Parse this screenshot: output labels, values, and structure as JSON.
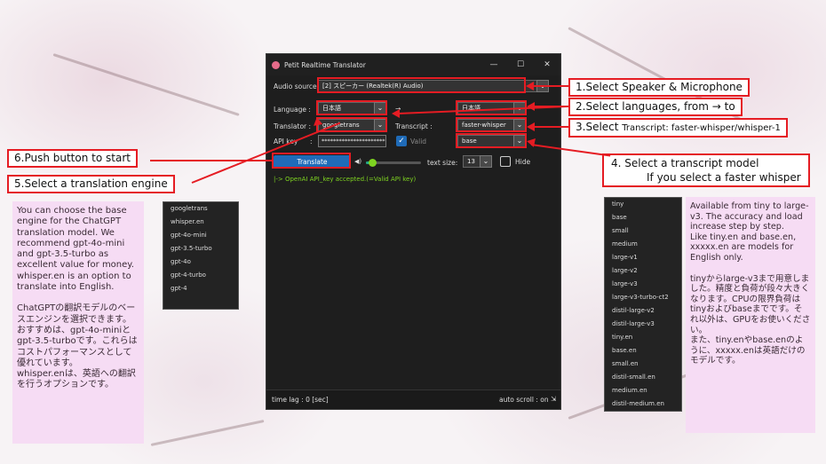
{
  "window": {
    "title": "Petit Realtime Translator",
    "controls": {
      "minimize": "—",
      "maximize": "☐",
      "close": "✕"
    }
  },
  "audio_source": {
    "label": "Audio source",
    "value": "[2] スピーカー (Realtek(R) Audio)"
  },
  "language": {
    "label": "Language :",
    "from": "日本語",
    "arrow": "→",
    "to": "日本語"
  },
  "translator": {
    "label": "Translator :",
    "value": "googletrans"
  },
  "transcript": {
    "label": "Transcript :",
    "value": "faster-whisper"
  },
  "api_key": {
    "label": "API key",
    "colon": ":",
    "value": "**********************",
    "valid_label": "Valid"
  },
  "model": {
    "value": "base"
  },
  "controls_row": {
    "translate_button": "Translate",
    "volume_icon": "speaker-icon",
    "volume_level": 0.12,
    "text_size_label": "text size:",
    "text_size_value": "13",
    "hide_label": "Hide"
  },
  "log": {
    "line": "|-> OpenAI API_key accepted.(=Valid API key)"
  },
  "status": {
    "time_lag": "time lag : 0 [sec]",
    "auto_scroll": "auto scroll : on",
    "resize_glyph": "⇲"
  },
  "callouts": {
    "c1": "1.Select Speaker & Microphone",
    "c2": "2.Select languages, from →  to",
    "c3_main": "3.Select ",
    "c3_small": "Transcript: faster-whisper/whisper-1",
    "c4_line1": "4. Select a transcript model",
    "c4_line2": "If you select a faster whisper",
    "c5": "5.Select a translation engine",
    "c6": "6.Push button to start"
  },
  "left_note": {
    "en": "You can choose the base engine for the ChatGPT translation model. We recommend gpt-4o-mini and gpt-3.5-turbo as excellent value for money.\n whisper.en is an option to translate into English.",
    "ja": "ChatGPTの翻訳モデルのベースエンジンを選択できます。おすすめは、gpt-4o-miniとgpt-3.5-turboです。これらはコストパフォーマンスとして優れています。\nwhisper.enは、英語への翻訳を行うオプションです。"
  },
  "translator_options": [
    "googletrans",
    "whisper.en",
    "gpt-4o-mini",
    "gpt-3.5-turbo",
    "gpt-4o",
    "gpt-4-turbo",
    "gpt-4"
  ],
  "model_options": [
    "tiny",
    "base",
    "small",
    "medium",
    "large-v1",
    "large-v2",
    "large-v3",
    "large-v3-turbo-ct2",
    "distil-large-v2",
    "distil-large-v3",
    "tiny.en",
    "base.en",
    "small.en",
    "distil-small.en",
    "medium.en",
    "distil-medium.en"
  ],
  "right_note": {
    "en": "Available from tiny to large-v3. The accuracy and load increase step by step.\n Like tiny.en and base.en, xxxxx.en are models for English only.",
    "ja": "tinyからlarge-v3まで用意しました。精度と負荷が段々大きくなります。CPUの限界負荷はtinyおよびbaseまでです。それ以外は、GPUをお使いください。\nまた、tiny.enやbase.enのように、xxxxx.enは英語だけのモデルです。"
  },
  "colors": {
    "accent_red": "#e51c23",
    "note_bg": "#f6dcf4",
    "button_blue": "#1f6bb8",
    "log_green": "#7ed321"
  }
}
